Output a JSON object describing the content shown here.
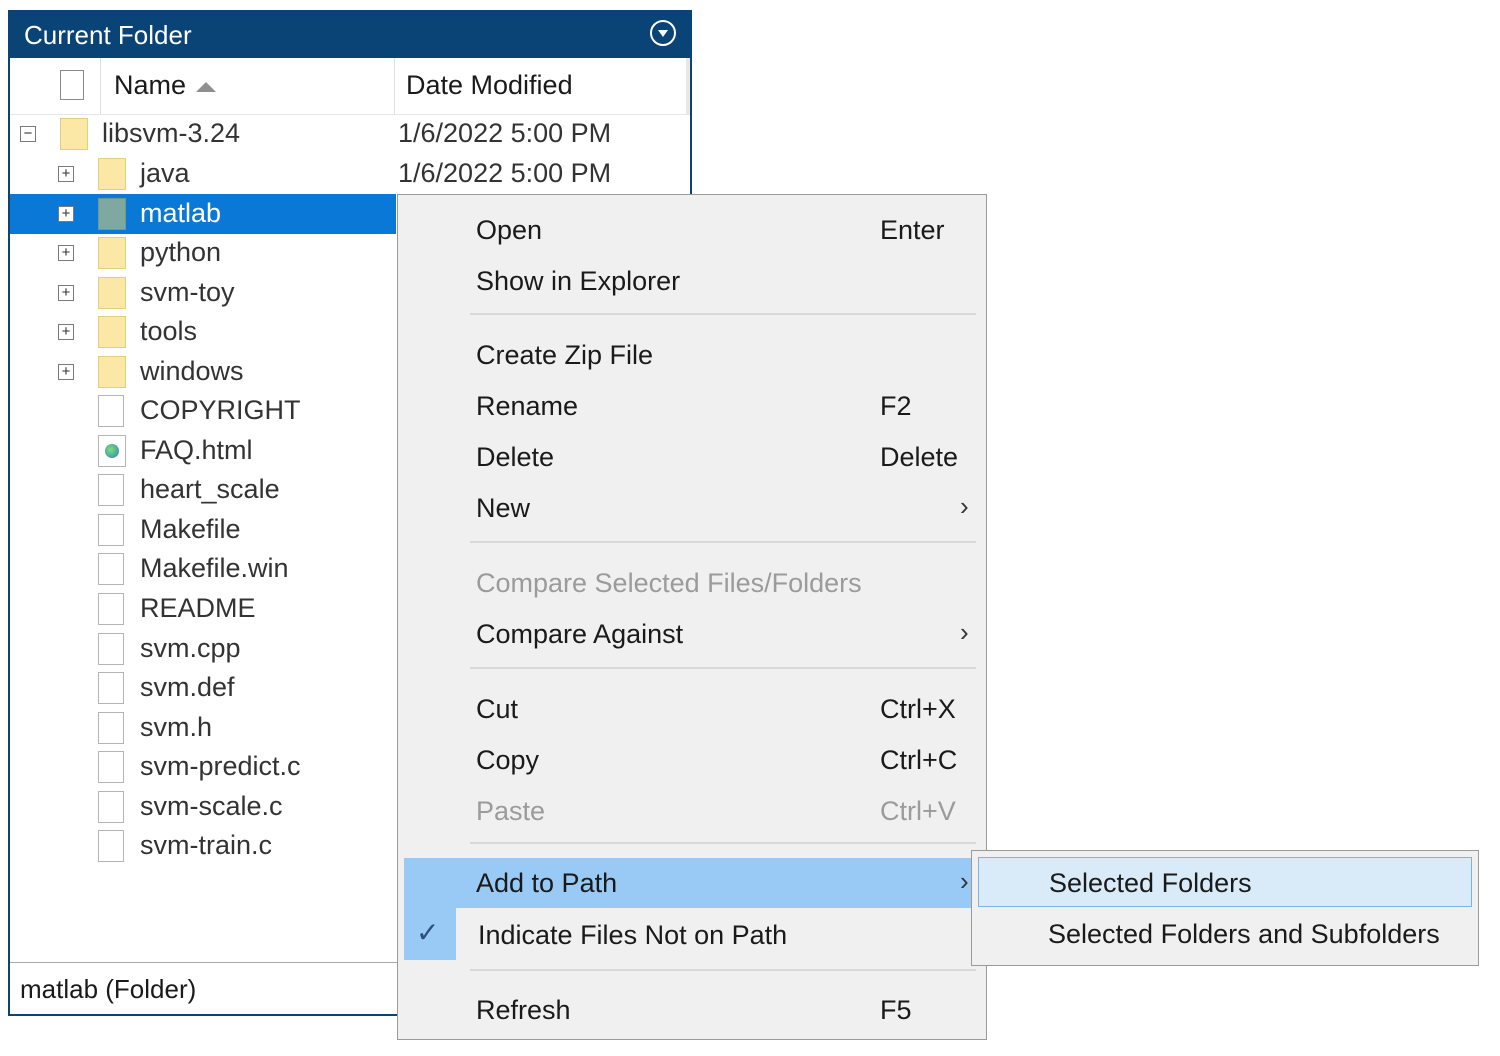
{
  "panel": {
    "title": "Current Folder",
    "columns": {
      "name": "Name",
      "date": "Date Modified"
    },
    "rows": [
      {
        "name": "libsvm-3.24",
        "date": "1/6/2022 5:00 PM",
        "toggle": "−",
        "kind": "folder"
      },
      {
        "name": "java",
        "date": "1/6/2022 5:00 PM",
        "toggle": "+",
        "kind": "folder"
      },
      {
        "name": "matlab",
        "date": "",
        "toggle": "+",
        "kind": "folder-selected"
      },
      {
        "name": "python",
        "date": "",
        "toggle": "+",
        "kind": "folder"
      },
      {
        "name": "svm-toy",
        "date": "",
        "toggle": "+",
        "kind": "folder"
      },
      {
        "name": "tools",
        "date": "",
        "toggle": "+",
        "kind": "folder"
      },
      {
        "name": "windows",
        "date": "",
        "toggle": "+",
        "kind": "folder"
      },
      {
        "name": "COPYRIGHT",
        "date": "",
        "toggle": "",
        "kind": "file"
      },
      {
        "name": "FAQ.html",
        "date": "",
        "toggle": "",
        "kind": "html"
      },
      {
        "name": "heart_scale",
        "date": "",
        "toggle": "",
        "kind": "file"
      },
      {
        "name": "Makefile",
        "date": "",
        "toggle": "",
        "kind": "file"
      },
      {
        "name": "Makefile.win",
        "date": "",
        "toggle": "",
        "kind": "file"
      },
      {
        "name": "README",
        "date": "",
        "toggle": "",
        "kind": "file"
      },
      {
        "name": "svm.cpp",
        "date": "",
        "toggle": "",
        "kind": "file"
      },
      {
        "name": "svm.def",
        "date": "",
        "toggle": "",
        "kind": "file"
      },
      {
        "name": "svm.h",
        "date": "",
        "toggle": "",
        "kind": "file"
      },
      {
        "name": "svm-predict.c",
        "date": "",
        "toggle": "",
        "kind": "file"
      },
      {
        "name": "svm-scale.c",
        "date": "",
        "toggle": "",
        "kind": "file"
      },
      {
        "name": "svm-train.c",
        "date": "",
        "toggle": "",
        "kind": "file"
      }
    ],
    "status": "matlab  (Folder)"
  },
  "menu": {
    "items": [
      {
        "label": "Open",
        "shortcut": "Enter"
      },
      {
        "label": "Show in Explorer",
        "shortcut": ""
      },
      {
        "label": "Create Zip File",
        "shortcut": ""
      },
      {
        "label": "Rename",
        "shortcut": "F2"
      },
      {
        "label": "Delete",
        "shortcut": "Delete"
      },
      {
        "label": "New",
        "shortcut": "",
        "submenu": true
      },
      {
        "label": "Compare Selected Files/Folders",
        "shortcut": "",
        "disabled": true
      },
      {
        "label": "Compare Against",
        "shortcut": "",
        "submenu": true
      },
      {
        "label": "Cut",
        "shortcut": "Ctrl+X"
      },
      {
        "label": "Copy",
        "shortcut": "Ctrl+C"
      },
      {
        "label": "Paste",
        "shortcut": "Ctrl+V",
        "disabled": true
      },
      {
        "label": "Add to Path",
        "shortcut": "",
        "submenu": true,
        "highlighted": true
      },
      {
        "label": "Indicate Files Not on Path",
        "shortcut": "",
        "checked": true
      },
      {
        "label": "Refresh",
        "shortcut": "F5"
      }
    ],
    "arrow_glyph": "›",
    "check_glyph": "✓"
  },
  "submenu": {
    "items": [
      {
        "label": "Selected Folders",
        "highlighted": true
      },
      {
        "label": "Selected Folders and Subfolders"
      }
    ]
  },
  "colors": {
    "titlebar": "#0a4477",
    "selection": "#0a78d7",
    "menu_highlight": "#99c9f5"
  }
}
